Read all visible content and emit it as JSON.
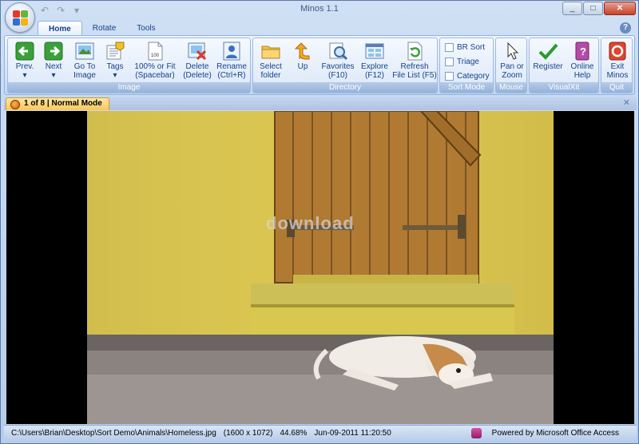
{
  "window": {
    "title": "Minos 1.1"
  },
  "tabs": [
    {
      "label": "Home"
    },
    {
      "label": "Rotate"
    },
    {
      "label": "Tools"
    }
  ],
  "help_label": "?",
  "ribbon": {
    "groups": {
      "image": "Image",
      "directory": "Directory",
      "sort_mode": "Sort Mode",
      "mouse": "Mouse",
      "visualxit": "VisualXit",
      "quit": "Quit"
    },
    "buttons": {
      "prev": "Prev.",
      "next": "Next",
      "goto_1": "Go To",
      "goto_2": "Image",
      "tags": "Tags",
      "fit_1": "100% or Fit",
      "fit_2": "(Spacebar)",
      "delete_1": "Delete",
      "delete_2": "(Delete)",
      "rename_1": "Rename",
      "rename_2": "(Ctrl+R)",
      "select_1": "Select",
      "select_2": "folder",
      "up": "Up",
      "fav_1": "Favorites",
      "fav_2": "(F10)",
      "explore_1": "Explore",
      "explore_2": "(F12)",
      "refresh_1": "Refresh",
      "refresh_2": "File List (F5)",
      "pan_1": "Pan or",
      "pan_2": "Zoom",
      "register": "Register",
      "online_1": "Online",
      "online_2": "Help",
      "exit_1": "Exit",
      "exit_2": "Minos"
    },
    "sort_checks": [
      {
        "label": "BR Sort",
        "checked": false
      },
      {
        "label": "Triage",
        "checked": false
      },
      {
        "label": "Category",
        "checked": false
      }
    ]
  },
  "doc_tab": {
    "label": "1 of 8  |  Normal Mode"
  },
  "image": {
    "watermark": "download"
  },
  "status": {
    "path": "C:\\Users\\Brian\\Desktop\\Sort Demo\\Animals\\Homeless.jpg",
    "dimensions": "(1600 x 1072)",
    "zoom": "44.68%",
    "date": "Jun-09-2011 11:20:50",
    "powered": "Powered by Microsoft Office Access"
  }
}
